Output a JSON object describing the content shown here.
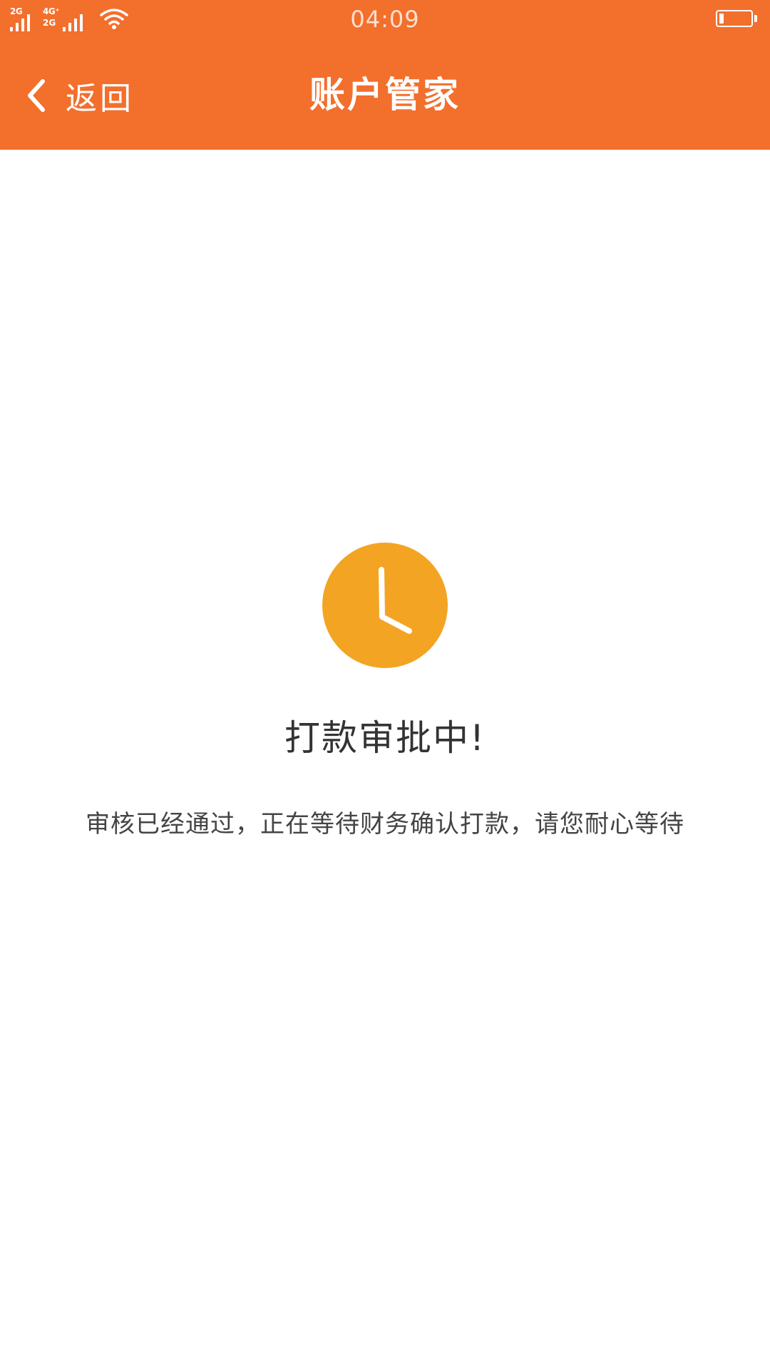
{
  "status_bar": {
    "sim1_network": "2G",
    "sim2_network_top": "4G⁺",
    "sim2_network_bottom": "2G",
    "time": "04:09",
    "battery_level": 0.15
  },
  "nav": {
    "back_label": "返回",
    "title": "账户管家"
  },
  "content": {
    "status_title": "打款审批中!",
    "status_description": "审核已经通过，正在等待财务确认打款，请您耐心等待"
  },
  "colors": {
    "header": "#f36f2c",
    "clock": "#f3a423",
    "background": "#ffffff"
  },
  "icons": {
    "back": "chevron-left-icon",
    "status": "clock-icon"
  }
}
